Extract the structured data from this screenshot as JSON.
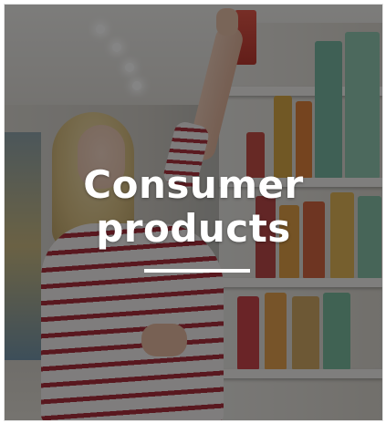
{
  "card": {
    "title_line1": "Consumer",
    "title_line2": "products",
    "image_subject": "supermarket-shopper-photo"
  },
  "colors": {
    "overlay": "#141414",
    "title_text": "#ffffff",
    "underline": "#ffffff",
    "stripe": "#a61f2d"
  }
}
